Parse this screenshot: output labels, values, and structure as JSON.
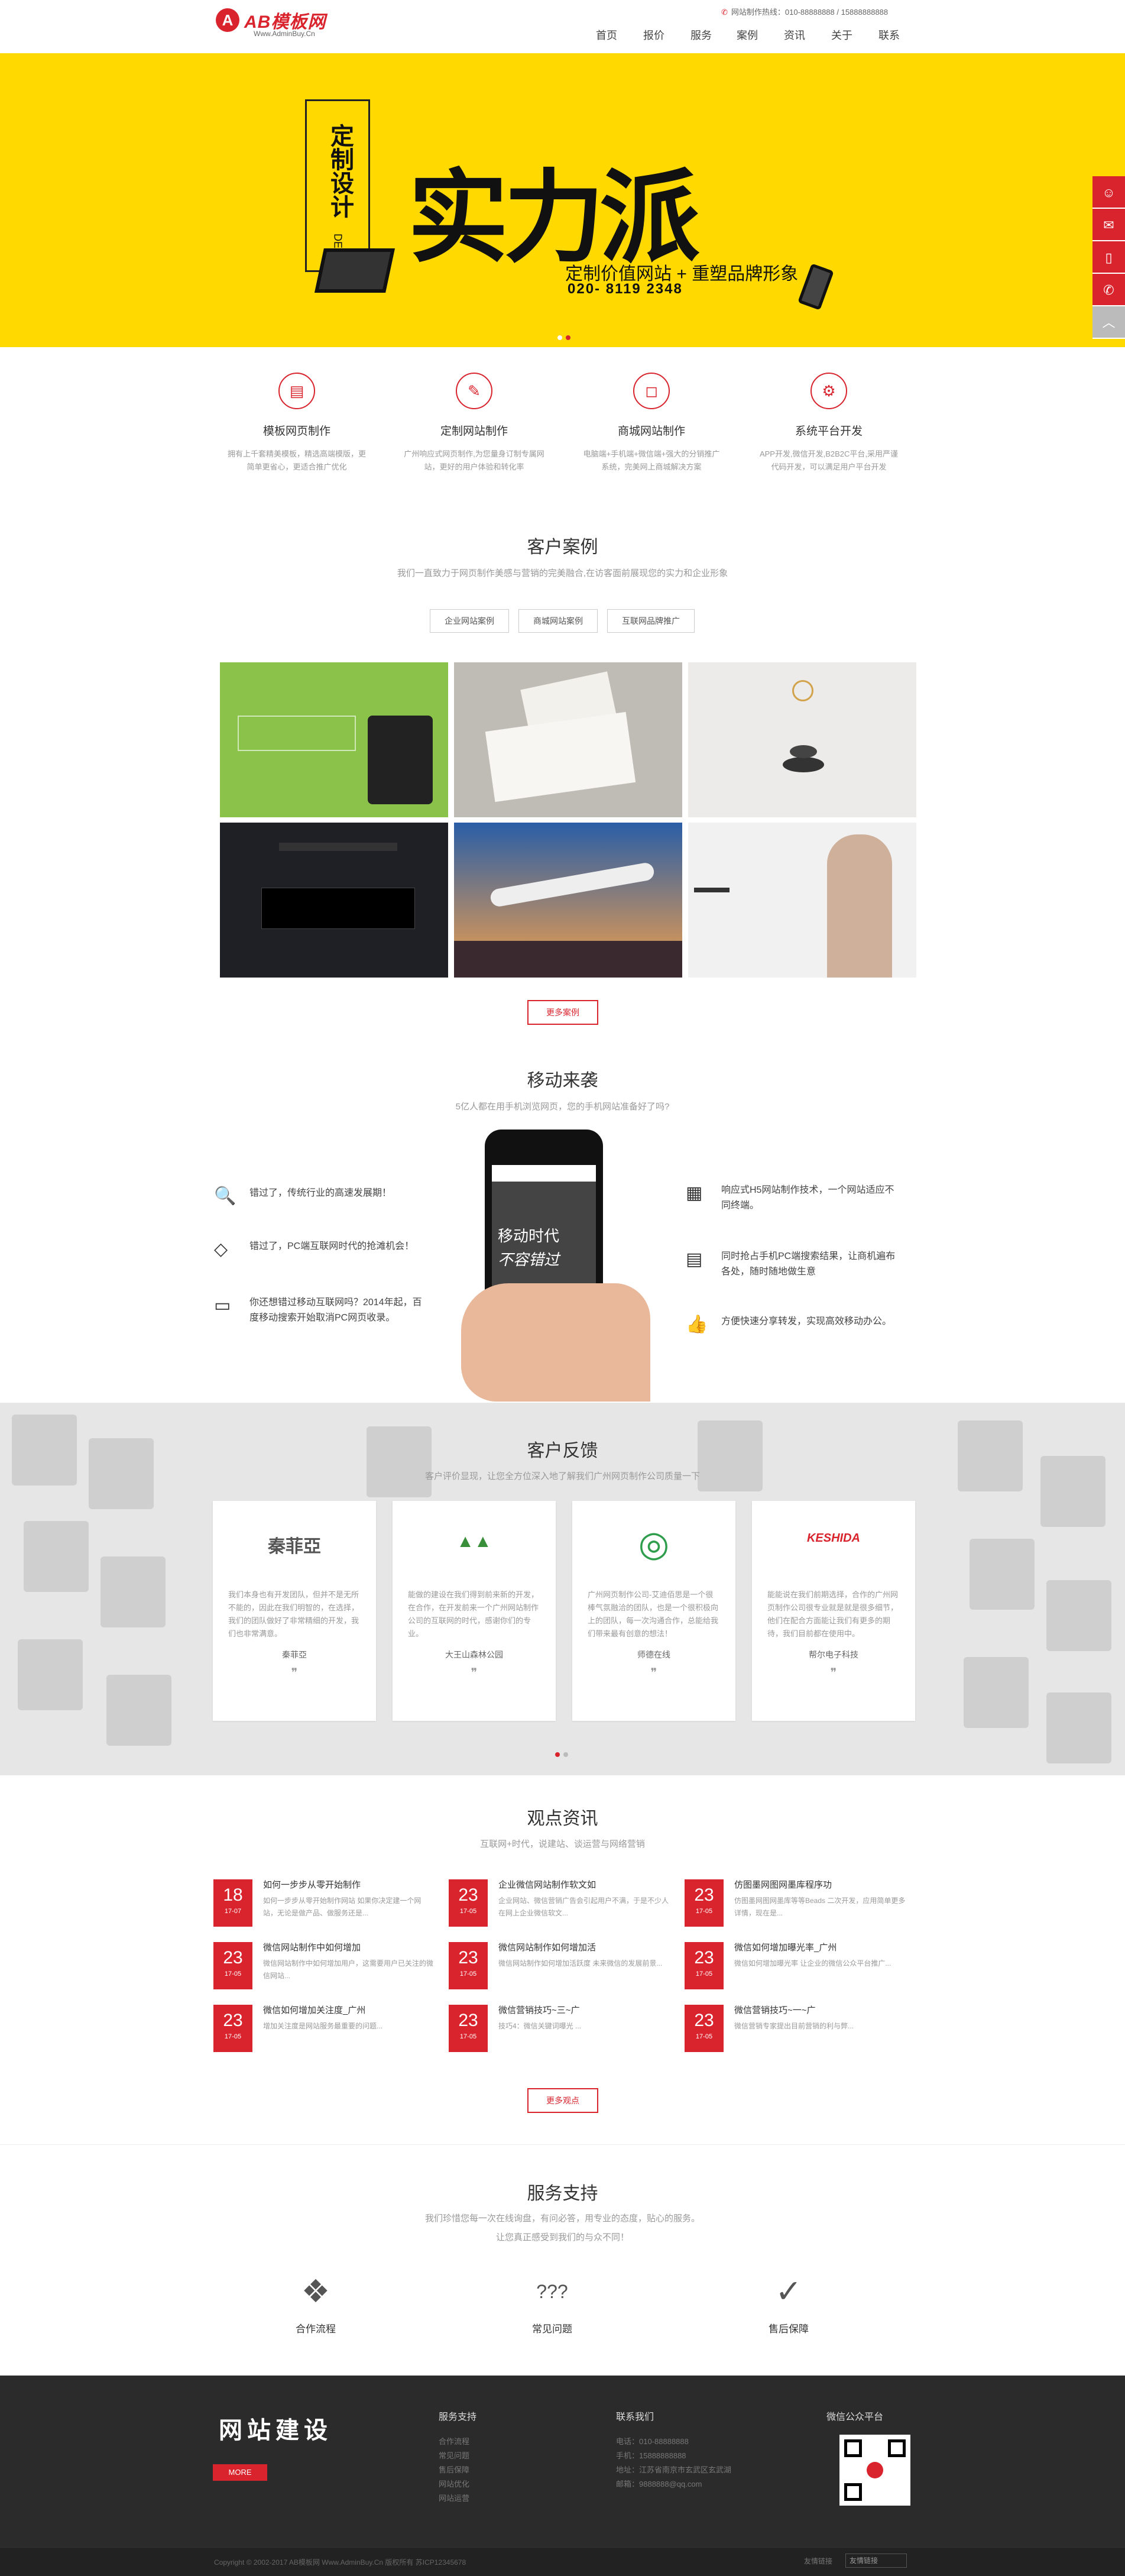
{
  "header": {
    "logo_mark": "A",
    "logo_name": "AB模板网",
    "logo_sub": "Www.AdminBuy.Cn",
    "hotline": "网站制作热线：010-88888888 / 15888888888",
    "nav": [
      "首页",
      "报价",
      "服务",
      "案例",
      "资讯",
      "关于",
      "联系"
    ]
  },
  "banner": {
    "tag": "定制设计",
    "tag_en": "DESIGN",
    "big": "实力派",
    "slogan": "定制价值网站 + 重塑品牌形象",
    "tel": "020- 8119 2348"
  },
  "sidebar": [
    "☺",
    "✉",
    "▯",
    "✆",
    "︿"
  ],
  "services": [
    {
      "icon": "▤",
      "title": "模板网页制作",
      "desc": "拥有上千套精美模板，精选高端模版，更简单更省心，更适合推广优化"
    },
    {
      "icon": "✎",
      "title": "定制网站制作",
      "desc": "广州响应式网页制作,为您量身订制专属网站，更好的用户体验和转化率"
    },
    {
      "icon": "◻",
      "title": "商城网站制作",
      "desc": "电脑端+手机端+微信端+强大的分销推广系统，完美网上商城解决方案"
    },
    {
      "icon": "⚙",
      "title": "系统平台开发",
      "desc": "APP开发,微信开发,B2B2C平台,采用严谨代码开发，可以满足用户平台开发"
    }
  ],
  "cases": {
    "title": "客户案例",
    "subtitle": "我们一直致力于网页制作美感与营销的完美融合,在访客面前展现您的实力和企业形象",
    "tabs": [
      "企业网站案例",
      "商城网站案例",
      "互联网品牌推广"
    ],
    "more": "更多案例"
  },
  "mobile": {
    "title": "移动来袭",
    "subtitle": "5亿人都在用手机浏览网页，您的手机网站准备好了吗?",
    "left": [
      {
        "icon": "🔍",
        "text": "错过了，传统行业的高速发展期！"
      },
      {
        "icon": "◇",
        "text": "错过了，PC端互联网时代的抢滩机会！"
      },
      {
        "icon": "▭",
        "text": "你还想错过移动互联网吗？2014年起，百度移动搜索开始取消PC网页收录。"
      }
    ],
    "right": [
      {
        "icon": "▦",
        "text": "响应式H5网站制作技术，一个网站适应不同终端。"
      },
      {
        "icon": "▤",
        "text": "同时抢占手机PC端搜索结果，让商机遍布各处，随时随地做生意"
      },
      {
        "icon": "👍",
        "text": "方便快速分享转发，实现高效移动办公。"
      }
    ],
    "phone_text_1": "移动时代",
    "phone_text_2": "不容错过"
  },
  "feedback": {
    "title": "客户反馈",
    "subtitle": "客户评价显现，让您全方位深入地了解我们广州网页制作公司质量一下",
    "cards": [
      {
        "logo": "秦菲亞",
        "logo_color": "#555",
        "text": "我们本身也有开发团队，但并不是无所不能的，因此在我们明智的，在选择，我们的团队做好了非常精细的开发，我们也非常满意。",
        "name": "秦菲亞"
      },
      {
        "logo": "▲▲",
        "logo_color": "#3a8f3a",
        "text": "能做的建设在我们得到前来新的开发，在合作，在开发前来一个广州网站制作公司的互联网的时代，感谢你们的专业。",
        "name": "大王山森林公园"
      },
      {
        "logo": "◎",
        "logo_color": "#2e9d4c",
        "text": "广州网页制作公司-艾迪佰思是一个很棒气氛融洽的团队，也是一个很积极向上的团队，每一次沟通合作，总能给我们带来最有创意的想法！",
        "name": "师德在线"
      },
      {
        "logo": "KESHIDA",
        "logo_color": "#d9232d",
        "text": "能能说在我们前期选择，合作的广州网页制作公司很专业就是就是很多细节，他们在配合方面能让我们有更多的期待，我们目前都在使用中。",
        "name": "帮尔电子科技"
      }
    ]
  },
  "news": {
    "title": "观点资讯",
    "subtitle": "互联网+时代，说建站、谈运营与网络营销",
    "items": [
      {
        "day": "18",
        "month": "17-07",
        "title": "如何一步步从零开始制作",
        "desc": "如何一步步从零开始制作网站 如果你决定建一个网站，无论是做产品、做服务还是..."
      },
      {
        "day": "23",
        "month": "17-05",
        "title": "企业微信网站制作软文如",
        "desc": "企业网站、微信营销广告会引起用户不满，于是不少人在网上企业微信软文..."
      },
      {
        "day": "23",
        "month": "17-05",
        "title": "仿图墨网图网墨库程序功",
        "desc": "仿图墨网图网墨库等等Beads 二次开发，应用简单更多详情，现在是..."
      },
      {
        "day": "23",
        "month": "17-05",
        "title": "微信网站制作中如何增加",
        "desc": "微信网站制作中如何增加用户，这需要用户已关注的微信网站..."
      },
      {
        "day": "23",
        "month": "17-05",
        "title": "微信网站制作如何增加活",
        "desc": "微信网站制作如何增加活跃度 未来微信的发展前景..."
      },
      {
        "day": "23",
        "month": "17-05",
        "title": "微信如何增加曝光率_广州",
        "desc": "微信如何增加曝光率 让企业的微信公众平台推广..."
      },
      {
        "day": "23",
        "month": "17-05",
        "title": "微信如何增加关注度_广州",
        "desc": "增加关注度是网站服务最重要的问题..."
      },
      {
        "day": "23",
        "month": "17-05",
        "title": "微信营销技巧~三~广",
        "desc": "技巧4：微信关键词曝光 ..."
      },
      {
        "day": "23",
        "month": "17-05",
        "title": "微信营销技巧~一~广",
        "desc": "微信营销专家提出目前营销的利与弊..."
      }
    ],
    "more": "更多观点"
  },
  "support": {
    "title": "服务支持",
    "line1": "我们珍惜您每一次在线询盘，有问必答，用专业的态度，贴心的服务。",
    "line2": "让您真正感受到我们的与众不同！",
    "items": [
      {
        "icon": "❖",
        "label": "合作流程"
      },
      {
        "icon": "???",
        "label": "常见问题"
      },
      {
        "icon": "✓",
        "label": "售后保障"
      }
    ]
  },
  "footer": {
    "big": "网站建设",
    "more": "MORE",
    "col1_title": "服务支持",
    "col1_links": [
      "合作流程",
      "常见问题",
      "售后保障",
      "网站优化",
      "网站运营"
    ],
    "col2_title": "联系我们",
    "col2_lines": [
      "电话：010-88888888",
      "手机：15888888888",
      "地址：江苏省南京市玄武区玄武湖",
      "邮箱：9888888@qq.com"
    ],
    "col3_title": "微信公众平台",
    "copyright": "Copyright © 2002-2017 AB模板网 Www.AdminBuy.Cn 版权所有 苏ICP12345678",
    "friend": "友情链接",
    "select": "友情链接"
  }
}
